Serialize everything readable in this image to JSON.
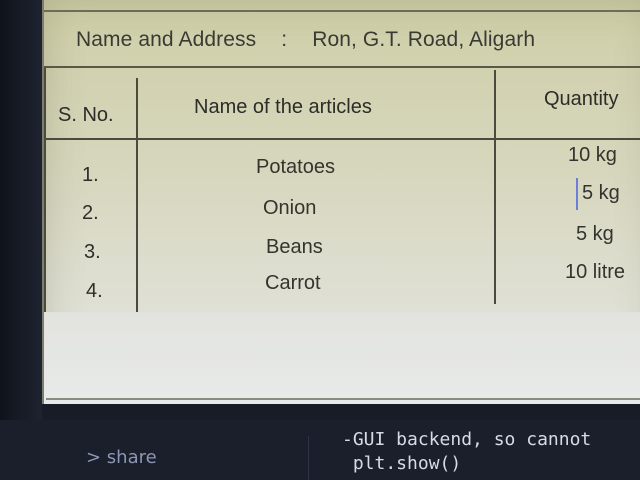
{
  "document": {
    "name_label": "Name and Address",
    "separator": ":",
    "name_value": "Ron, G.T. Road, Aligarh",
    "table": {
      "headers": [
        "S. No.",
        "Name of the articles",
        "Quantity"
      ],
      "rows": [
        {
          "sno": "1.",
          "article": "Potatoes",
          "quantity": "10 kg"
        },
        {
          "sno": "2.",
          "article": "Onion",
          "quantity": "5 kg"
        },
        {
          "sno": "3.",
          "article": "Beans",
          "quantity": "5 kg"
        },
        {
          "sno": "4.",
          "article": "Carrot",
          "quantity": "10 litre"
        }
      ]
    }
  },
  "bottom_bar": {
    "share_label": "> share",
    "console_lines": [
      "-GUI backend, so cannot",
      " plt.show()"
    ]
  },
  "colors": {
    "paper": "#d6d6bc",
    "ink": "#2c2c28",
    "background": "#171c27",
    "console_text": "#d8dbe4",
    "share_text": "#8d96b4"
  }
}
